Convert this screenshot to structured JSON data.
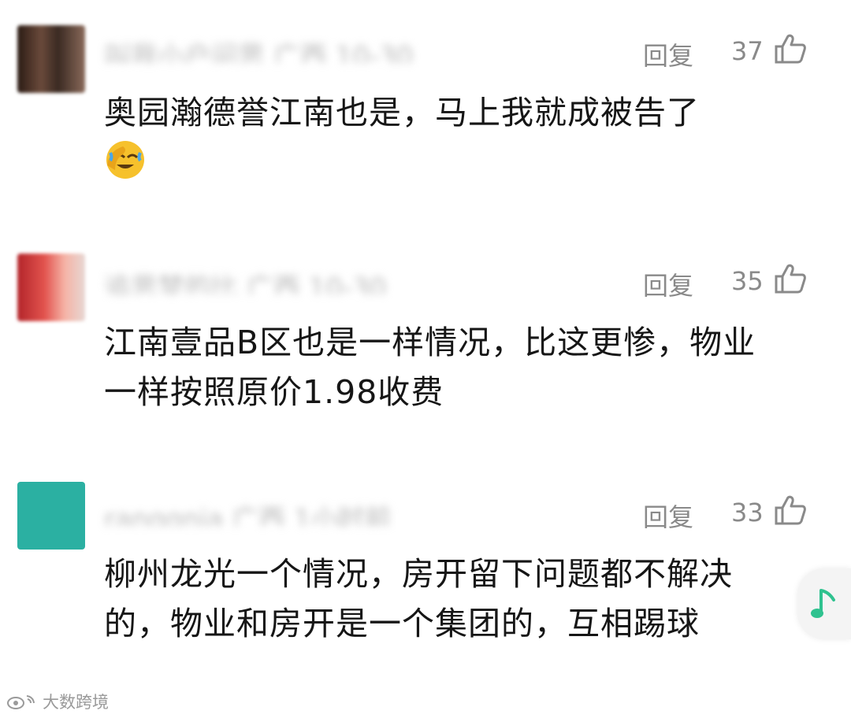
{
  "comments": [
    {
      "username": "叫我小户问思 广西 10-30",
      "reply_label": "回复",
      "likes": "37",
      "text": "奥园瀚德誉江南也是，马上我就成被告了",
      "has_emoji": true
    },
    {
      "username": "追思梦的比 广西 10-30",
      "reply_label": "回复",
      "likes": "35",
      "text": "江南壹品B区也是一样情况，比这更惨，物业一样按照原价1.98收费",
      "has_emoji": false
    },
    {
      "username": "ranggnia 广西 1小时前",
      "reply_label": "回复",
      "likes": "33",
      "text": "柳州龙光一个情况，房开留下问题都不解决的，物业和房开是一个集团的，互相踢球",
      "has_emoji": false
    }
  ],
  "watermark": {
    "text": "大数跨境"
  },
  "icons": {
    "like": "thumbs-up-icon",
    "emoji": "facepalm-laugh-emoji-icon",
    "music": "music-note-icon"
  },
  "colors": {
    "meta_gray": "#8a8a8a",
    "music_green": "#2fc28f",
    "emoji_yellow": "#f6c12c"
  }
}
